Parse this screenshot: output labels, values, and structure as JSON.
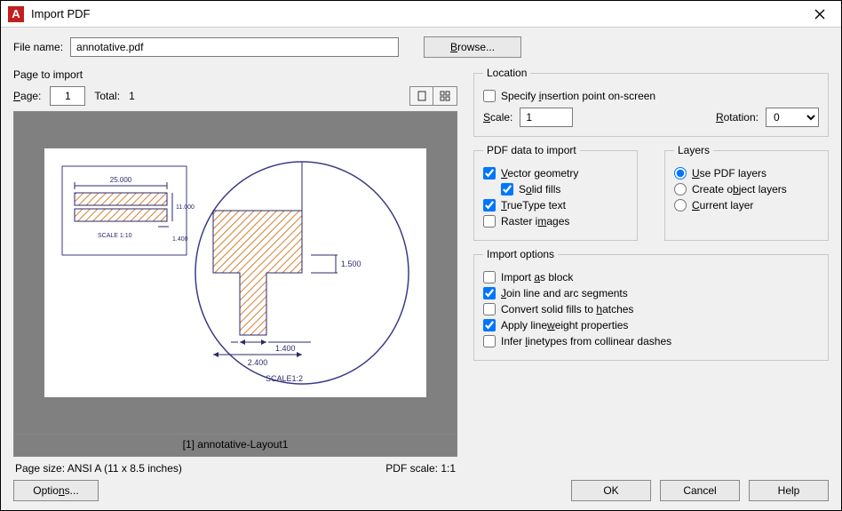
{
  "window": {
    "title": "Import PDF",
    "app_icon_letter": "A"
  },
  "file": {
    "label": "File name:",
    "value": "annotative.pdf",
    "browse_label": "Browse..."
  },
  "left": {
    "group_title": "Page to import",
    "page_label": "Page:",
    "page_value": "1",
    "total_label": "Total:",
    "total_value": "1",
    "preview_caption": "[1] annotative-Layout1",
    "page_size_label": "Page size:",
    "page_size_value": "ANSI A (11 x 8.5 inches)",
    "pdf_scale_label": "PDF scale:",
    "pdf_scale_value": "1:1",
    "drawing": {
      "dim_25": "25.000",
      "dim_11": "11.000",
      "dim_1400s": "1.400",
      "scale_1_10": "SCALE 1:10",
      "dim_1500": "1.500",
      "dim_1400": "1.400",
      "dim_2400": "2.400",
      "scale_1_2": "SCALE1:2"
    }
  },
  "location": {
    "legend": "Location",
    "specify_label": "Specify insertion point on-screen",
    "specify_checked": false,
    "scale_label": "Scale:",
    "scale_value": "1",
    "rotation_label": "Rotation:",
    "rotation_value": "0"
  },
  "pdf_data": {
    "legend": "PDF data to import",
    "vector_label": "Vector geometry",
    "vector_checked": true,
    "solid_label": "Solid fills",
    "solid_checked": true,
    "truetype_label": "TrueType text",
    "truetype_checked": true,
    "raster_label": "Raster images",
    "raster_checked": false
  },
  "layers": {
    "legend": "Layers",
    "use_pdf_label": "Use PDF layers",
    "create_obj_label": "Create object layers",
    "current_label": "Current layer",
    "selected": "use_pdf"
  },
  "import_options": {
    "legend": "Import options",
    "block_label": "Import as block",
    "block_checked": false,
    "join_label": "Join line and arc segments",
    "join_checked": true,
    "hatches_label": "Convert solid fills to hatches",
    "hatches_checked": false,
    "lineweight_label": "Apply lineweight properties",
    "lineweight_checked": true,
    "linetypes_label": "Infer linetypes from collinear dashes",
    "linetypes_checked": false
  },
  "footer": {
    "options_label": "Options...",
    "ok_label": "OK",
    "cancel_label": "Cancel",
    "help_label": "Help"
  }
}
